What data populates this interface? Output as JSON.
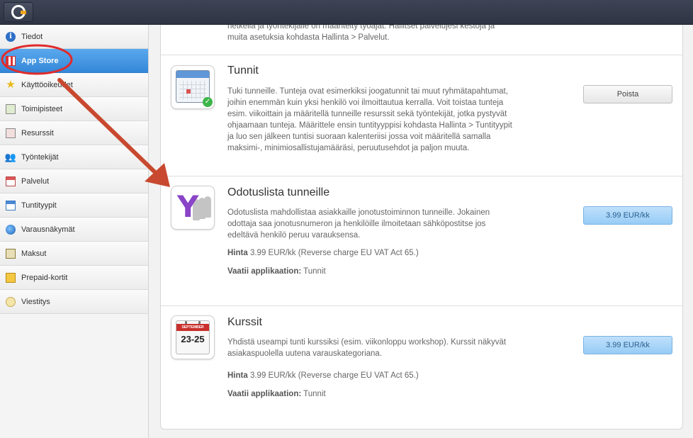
{
  "topbar": {
    "logo": "logo-icon"
  },
  "sidebar": {
    "items": [
      {
        "label": "Tiedot",
        "icon": "info-icon"
      },
      {
        "label": "App Store",
        "icon": "store-icon",
        "active": true
      },
      {
        "label": "Käyttöoikeudet",
        "icon": "star-icon"
      },
      {
        "label": "Toimipisteet",
        "icon": "location-icon"
      },
      {
        "label": "Resurssit",
        "icon": "resource-icon"
      },
      {
        "label": "Työntekijät",
        "icon": "people-icon"
      },
      {
        "label": "Palvelut",
        "icon": "calendar-icon"
      },
      {
        "label": "Tuntityypit",
        "icon": "calendar-icon"
      },
      {
        "label": "Varausnäkymät",
        "icon": "globe-icon"
      },
      {
        "label": "Maksut",
        "icon": "money-icon"
      },
      {
        "label": "Prepaid-kortit",
        "icon": "vip-card-icon"
      },
      {
        "label": "Viestitys",
        "icon": "chat-icon"
      }
    ]
  },
  "apps": {
    "partial_desc_line1": "hetkellä ja työntekijälle on määritelty työajat. Hallitset palvelujesi kestoja ja",
    "partial_desc_line2": "muita asetuksia kohdasta Hallinta > Palvelut.",
    "tunnit": {
      "title": "Tunnit",
      "desc": "Tuki tunneille. Tunteja ovat esimerkiksi joogatunnit tai muut ryhmätapahtumat, joihin enemmän kuin yksi henkilö voi ilmoittautua kerralla. Voit toistaa tunteja esim. viikoittain ja määritellä tunneille resurssit sekä työntekijät, jotka pystyvät ohjaamaan tunteja. Määrittele ensin tuntityyppisi kohdasta Hallinta > Tuntityypit ja luo sen jälkeen tuntisi suoraan kalenteriisi jossa voit määritellä samalla maksimi-, minimiosallistujamääräsi, peruutusehdot ja paljon muuta.",
      "button": "Poista"
    },
    "odotuslista": {
      "title": "Odotuslista tunneille",
      "desc": "Odotuslista mahdollistaa asiakkaille jonotustoiminnon tunneille. Jokainen odottaja saa jonotusnumeron ja henkilöille ilmoitetaan sähköpostitse jos edeltävä henkilö peruu varauksensa.",
      "price_label": "Hinta",
      "price": "3.99 EUR/kk (Reverse charge EU VAT Act 65.)",
      "requires_label": "Vaatii applikaation:",
      "requires": "Tunnit",
      "button": "3.99 EUR/kk"
    },
    "kurssit": {
      "title": "Kurssit",
      "desc": "Yhdistä useampi tunti kurssiksi (esim. viikonloppu workshop). Kurssit näkyvät asiakaspuolella uutena varauskategoriana.",
      "icon_month": "SEPTEMBER",
      "icon_days": "23-25",
      "price_label": "Hinta",
      "price": "3.99 EUR/kk (Reverse charge EU VAT Act 65.)",
      "requires_label": "Vaatii applikaation:",
      "requires": "Tunnit",
      "button": "3.99 EUR/kk"
    }
  },
  "annotation": {
    "circle_color": "#e02b2b",
    "arrow_color": "#c8492f"
  }
}
